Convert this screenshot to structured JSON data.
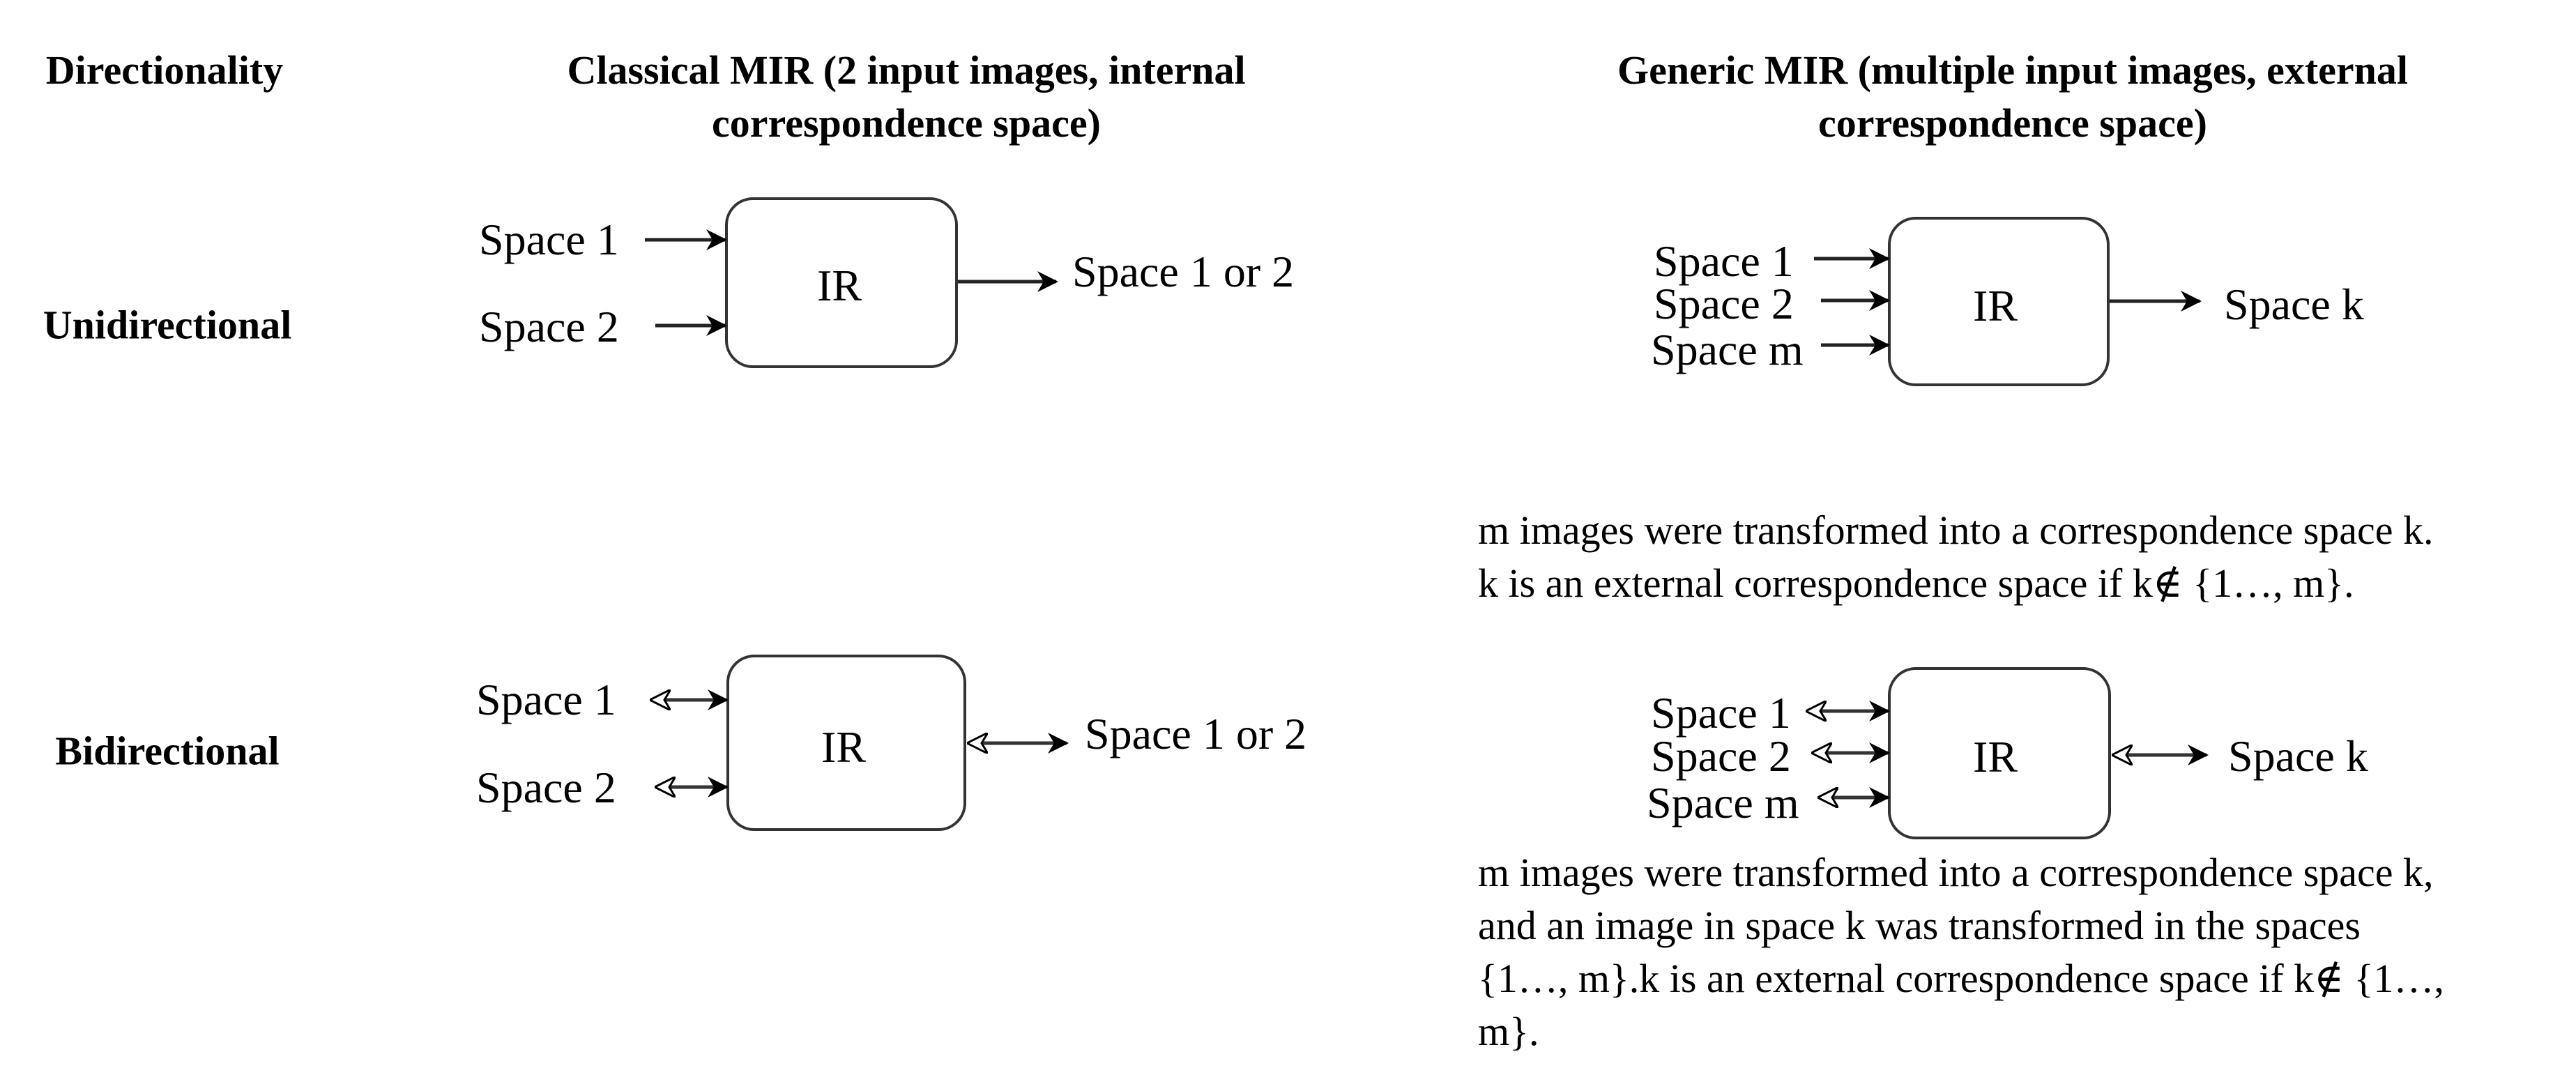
{
  "columns": {
    "directionality": "Directionality",
    "classical": [
      "Classical MIR (2 input images, internal",
      "correspondence space)"
    ],
    "generic": [
      "Generic MIR (multiple input images, external",
      "correspondence space)"
    ]
  },
  "rows": {
    "unidirectional": "Unidirectional",
    "bidirectional": "Bidirectional"
  },
  "diagrams": {
    "classical_uni": {
      "box": "IR",
      "inputs": [
        "Space 1",
        "Space 2"
      ],
      "output": "Space 1 or 2",
      "arrow": "one-way"
    },
    "generic_uni": {
      "box": "IR",
      "inputs": [
        "Space 1",
        "Space 2",
        "Space m"
      ],
      "output": "Space k",
      "arrow": "one-way"
    },
    "classical_bi": {
      "box": "IR",
      "inputs": [
        "Space 1",
        "Space 2"
      ],
      "output": "Space 1 or 2",
      "arrow": "two-way"
    },
    "generic_bi": {
      "box": "IR",
      "inputs": [
        "Space 1",
        "Space 2",
        "Space m"
      ],
      "output": "Space k",
      "arrow": "two-way"
    }
  },
  "notes": {
    "unidirectional": [
      "m images were transformed into a correspondence space k.",
      "k is an external correspondence space if k∉ {1…, m}."
    ],
    "bidirectional": [
      "m images were transformed into a correspondence space k,",
      "and an image in space k was transformed in the spaces",
      "{1…, m}.k is an external correspondence space if k∉ {1…,",
      "m}."
    ]
  }
}
